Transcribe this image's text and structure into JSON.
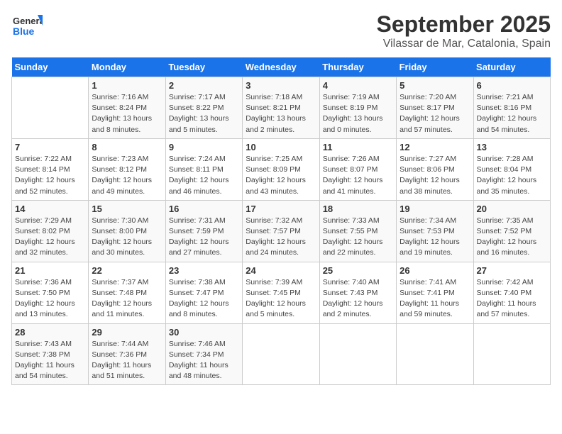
{
  "logo": {
    "line1": "General",
    "line2": "Blue"
  },
  "title": "September 2025",
  "subtitle": "Vilassar de Mar, Catalonia, Spain",
  "days_of_week": [
    "Sunday",
    "Monday",
    "Tuesday",
    "Wednesday",
    "Thursday",
    "Friday",
    "Saturday"
  ],
  "weeks": [
    [
      {
        "day": "",
        "info": ""
      },
      {
        "day": "1",
        "info": "Sunrise: 7:16 AM\nSunset: 8:24 PM\nDaylight: 13 hours\nand 8 minutes."
      },
      {
        "day": "2",
        "info": "Sunrise: 7:17 AM\nSunset: 8:22 PM\nDaylight: 13 hours\nand 5 minutes."
      },
      {
        "day": "3",
        "info": "Sunrise: 7:18 AM\nSunset: 8:21 PM\nDaylight: 13 hours\nand 2 minutes."
      },
      {
        "day": "4",
        "info": "Sunrise: 7:19 AM\nSunset: 8:19 PM\nDaylight: 13 hours\nand 0 minutes."
      },
      {
        "day": "5",
        "info": "Sunrise: 7:20 AM\nSunset: 8:17 PM\nDaylight: 12 hours\nand 57 minutes."
      },
      {
        "day": "6",
        "info": "Sunrise: 7:21 AM\nSunset: 8:16 PM\nDaylight: 12 hours\nand 54 minutes."
      }
    ],
    [
      {
        "day": "7",
        "info": "Sunrise: 7:22 AM\nSunset: 8:14 PM\nDaylight: 12 hours\nand 52 minutes."
      },
      {
        "day": "8",
        "info": "Sunrise: 7:23 AM\nSunset: 8:12 PM\nDaylight: 12 hours\nand 49 minutes."
      },
      {
        "day": "9",
        "info": "Sunrise: 7:24 AM\nSunset: 8:11 PM\nDaylight: 12 hours\nand 46 minutes."
      },
      {
        "day": "10",
        "info": "Sunrise: 7:25 AM\nSunset: 8:09 PM\nDaylight: 12 hours\nand 43 minutes."
      },
      {
        "day": "11",
        "info": "Sunrise: 7:26 AM\nSunset: 8:07 PM\nDaylight: 12 hours\nand 41 minutes."
      },
      {
        "day": "12",
        "info": "Sunrise: 7:27 AM\nSunset: 8:06 PM\nDaylight: 12 hours\nand 38 minutes."
      },
      {
        "day": "13",
        "info": "Sunrise: 7:28 AM\nSunset: 8:04 PM\nDaylight: 12 hours\nand 35 minutes."
      }
    ],
    [
      {
        "day": "14",
        "info": "Sunrise: 7:29 AM\nSunset: 8:02 PM\nDaylight: 12 hours\nand 32 minutes."
      },
      {
        "day": "15",
        "info": "Sunrise: 7:30 AM\nSunset: 8:00 PM\nDaylight: 12 hours\nand 30 minutes."
      },
      {
        "day": "16",
        "info": "Sunrise: 7:31 AM\nSunset: 7:59 PM\nDaylight: 12 hours\nand 27 minutes."
      },
      {
        "day": "17",
        "info": "Sunrise: 7:32 AM\nSunset: 7:57 PM\nDaylight: 12 hours\nand 24 minutes."
      },
      {
        "day": "18",
        "info": "Sunrise: 7:33 AM\nSunset: 7:55 PM\nDaylight: 12 hours\nand 22 minutes."
      },
      {
        "day": "19",
        "info": "Sunrise: 7:34 AM\nSunset: 7:53 PM\nDaylight: 12 hours\nand 19 minutes."
      },
      {
        "day": "20",
        "info": "Sunrise: 7:35 AM\nSunset: 7:52 PM\nDaylight: 12 hours\nand 16 minutes."
      }
    ],
    [
      {
        "day": "21",
        "info": "Sunrise: 7:36 AM\nSunset: 7:50 PM\nDaylight: 12 hours\nand 13 minutes."
      },
      {
        "day": "22",
        "info": "Sunrise: 7:37 AM\nSunset: 7:48 PM\nDaylight: 12 hours\nand 11 minutes."
      },
      {
        "day": "23",
        "info": "Sunrise: 7:38 AM\nSunset: 7:47 PM\nDaylight: 12 hours\nand 8 minutes."
      },
      {
        "day": "24",
        "info": "Sunrise: 7:39 AM\nSunset: 7:45 PM\nDaylight: 12 hours\nand 5 minutes."
      },
      {
        "day": "25",
        "info": "Sunrise: 7:40 AM\nSunset: 7:43 PM\nDaylight: 12 hours\nand 2 minutes."
      },
      {
        "day": "26",
        "info": "Sunrise: 7:41 AM\nSunset: 7:41 PM\nDaylight: 11 hours\nand 59 minutes."
      },
      {
        "day": "27",
        "info": "Sunrise: 7:42 AM\nSunset: 7:40 PM\nDaylight: 11 hours\nand 57 minutes."
      }
    ],
    [
      {
        "day": "28",
        "info": "Sunrise: 7:43 AM\nSunset: 7:38 PM\nDaylight: 11 hours\nand 54 minutes."
      },
      {
        "day": "29",
        "info": "Sunrise: 7:44 AM\nSunset: 7:36 PM\nDaylight: 11 hours\nand 51 minutes."
      },
      {
        "day": "30",
        "info": "Sunrise: 7:46 AM\nSunset: 7:34 PM\nDaylight: 11 hours\nand 48 minutes."
      },
      {
        "day": "",
        "info": ""
      },
      {
        "day": "",
        "info": ""
      },
      {
        "day": "",
        "info": ""
      },
      {
        "day": "",
        "info": ""
      }
    ]
  ]
}
